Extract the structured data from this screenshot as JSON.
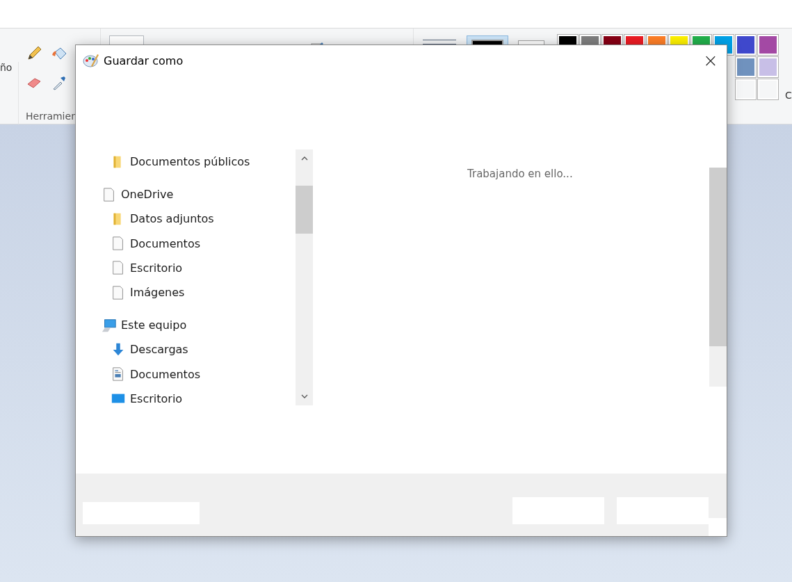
{
  "paint_window": {
    "ribbon": {
      "left_label": "ño",
      "tools_label": "Herramien",
      "colors_label": "C",
      "palette": [
        {
          "cells": [
            {
              "color": "#000000"
            },
            {
              "color": "#7f7f7f"
            },
            {
              "color": "#880015"
            },
            {
              "color": "#ed1c24"
            },
            {
              "color": "#ff7f27"
            },
            {
              "color": "#fff200"
            },
            {
              "color": "#22b14c"
            },
            {
              "color": "#00a2e8"
            },
            {
              "color": "#3f48cc"
            },
            {
              "color": "#a349a4"
            }
          ]
        },
        {
          "cells": [
            {
              "color": "#7092be"
            },
            {
              "color": "#c8bfe7"
            }
          ]
        },
        {
          "cells": [
            {
              "color": "#f5f6f7"
            },
            {
              "color": "#f5f6f7"
            }
          ]
        }
      ]
    }
  },
  "dialog": {
    "title": "Guardar como",
    "close": "×",
    "nav_items": [
      {
        "label": "Documentos públicos",
        "kind": "folder"
      },
      {
        "label": "OneDrive",
        "kind": "page",
        "children": [
          {
            "label": "Datos adjuntos",
            "kind": "folder"
          },
          {
            "label": "Documentos",
            "kind": "page"
          },
          {
            "label": "Escritorio",
            "kind": "page"
          },
          {
            "label": "Imágenes",
            "kind": "page"
          }
        ]
      },
      {
        "label": "Este equipo",
        "kind": "computer",
        "children": [
          {
            "label": "Descargas",
            "kind": "download"
          },
          {
            "label": "Documentos",
            "kind": "document"
          },
          {
            "label": "Escritorio",
            "kind": "desktop"
          }
        ]
      }
    ],
    "status_text": "Trabajando en ello..."
  }
}
